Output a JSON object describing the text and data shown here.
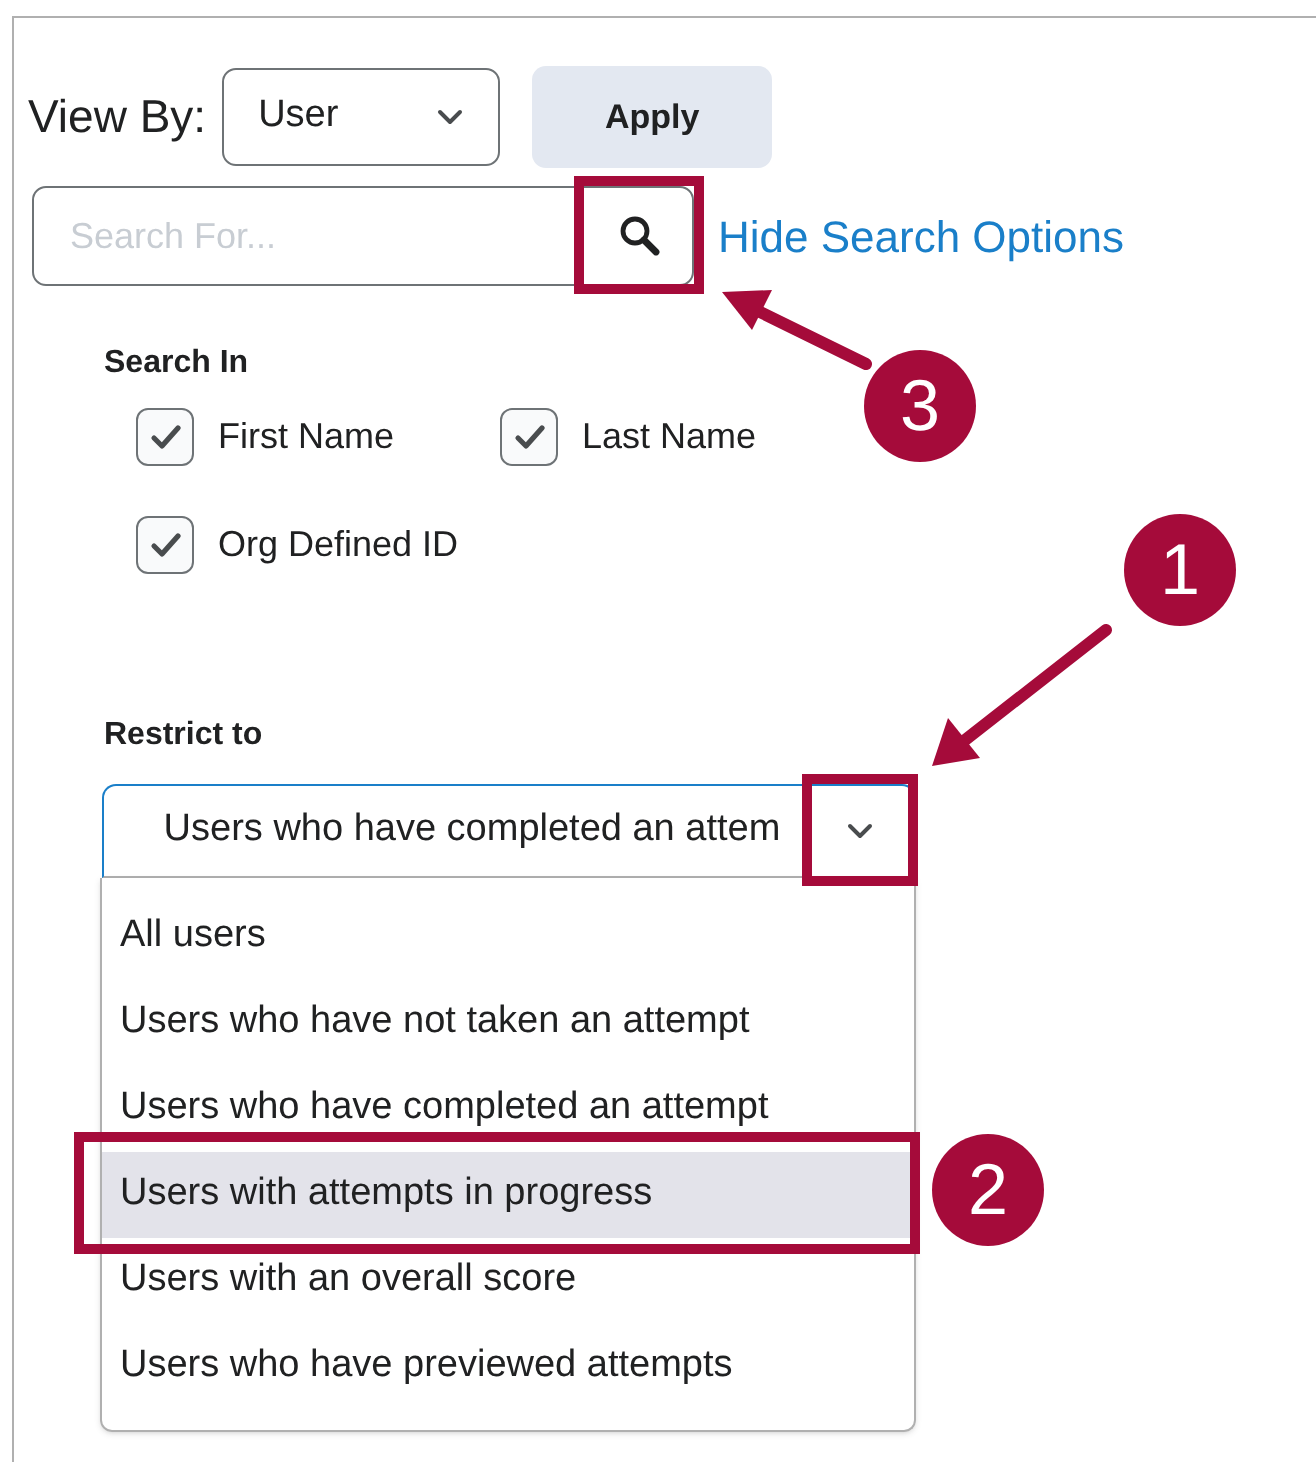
{
  "view_by": {
    "label": "View By:",
    "value": "User"
  },
  "apply_button": "Apply",
  "search": {
    "placeholder": "Search For..."
  },
  "hide_search_options": "Hide Search Options",
  "search_in": {
    "label": "Search In",
    "options": [
      {
        "label": "First Name",
        "checked": true
      },
      {
        "label": "Last Name",
        "checked": true
      },
      {
        "label": "Org Defined ID",
        "checked": true
      }
    ]
  },
  "restrict_to": {
    "label": "Restrict to",
    "value": "Users who have completed an attem",
    "options": [
      {
        "label": "All users",
        "selected": false
      },
      {
        "label": "Users who have not taken an attempt",
        "selected": false
      },
      {
        "label": "Users who have completed an attempt",
        "selected": false
      },
      {
        "label": "Users with attempts in progress",
        "selected": true
      },
      {
        "label": "Users with an overall score",
        "selected": false
      },
      {
        "label": "Users who have previewed attempts",
        "selected": false
      }
    ]
  },
  "callouts": [
    "1",
    "2",
    "3"
  ]
}
